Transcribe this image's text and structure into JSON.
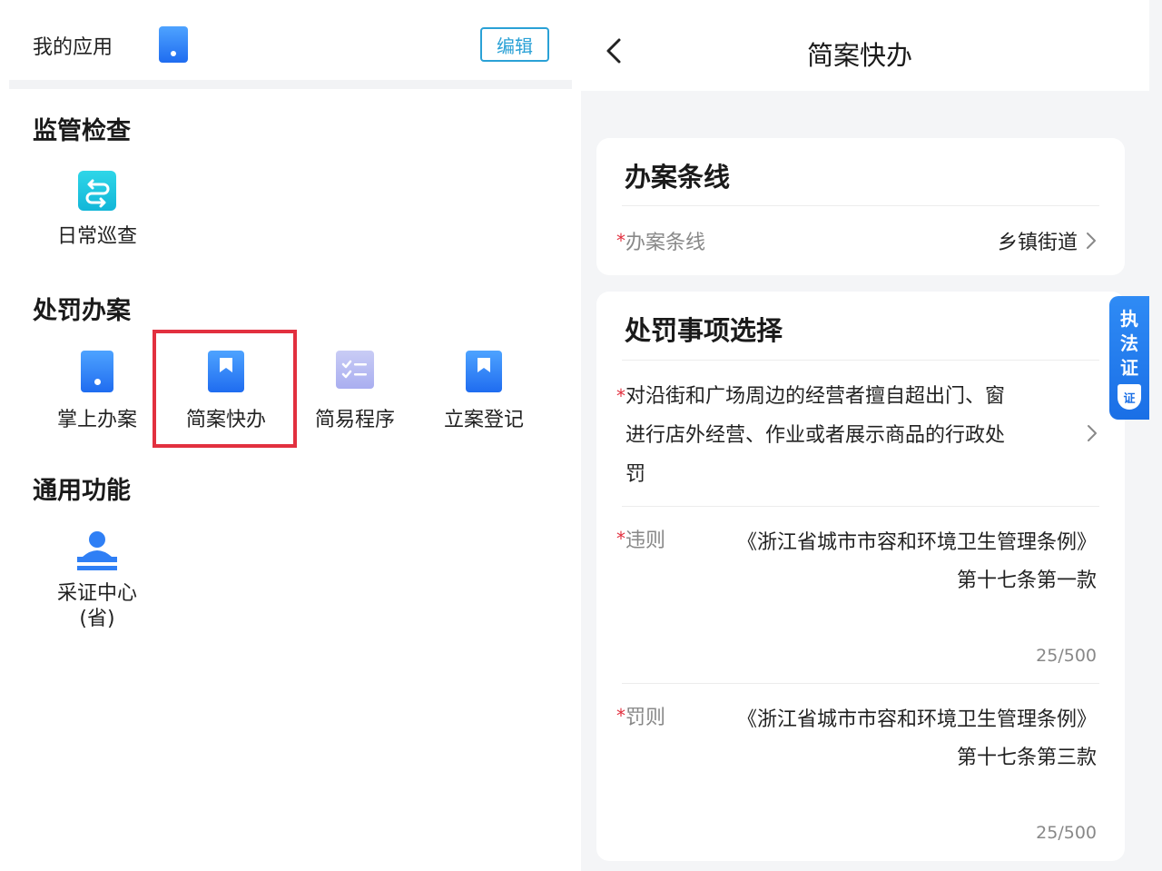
{
  "left": {
    "my_apps": {
      "title": "我的应用",
      "edit_label": "编辑"
    },
    "sections": [
      {
        "title": "监管检查",
        "items": [
          {
            "label": "日常巡查",
            "icon": "switch-arrows-icon"
          }
        ]
      },
      {
        "title": "处罚办案",
        "items": [
          {
            "label": "掌上办案",
            "icon": "phone-icon"
          },
          {
            "label": "简案快办",
            "icon": "bookmark-icon"
          },
          {
            "label": "简易程序",
            "icon": "checklist-icon"
          },
          {
            "label": "立案登记",
            "icon": "bookmark-icon"
          }
        ]
      },
      {
        "title": "通用功能",
        "items": [
          {
            "label_line1": "采证中心",
            "label_line2": "(省)",
            "icon": "stamp-icon"
          }
        ]
      }
    ]
  },
  "right": {
    "nav": {
      "title": "简案快办"
    },
    "card1": {
      "title": "办案条线",
      "field_label": "办案条线",
      "field_value": "乡镇街道"
    },
    "card2": {
      "title": "处罚事项选择",
      "matter_line1": "对沿街和广场周边的经营者擅自超出门、窗",
      "matter_line2": "进行店外经营、作业或者展示商品的行政处",
      "matter_line3": "罚",
      "violation_label": "违则",
      "violation_line1": "《浙江省城市市容和环境卫生管理条例》",
      "violation_line2": "第十七条第一款",
      "violation_counter": "25/500",
      "penalty_label": "罚则",
      "penalty_line1": "《浙江省城市市容和环境卫生管理条例》",
      "penalty_line2": "第十七条第三款",
      "penalty_counter": "25/500"
    },
    "badge": {
      "c1": "执",
      "c2": "法",
      "c3": "证",
      "shield": "证"
    },
    "required_mark": "*"
  },
  "colors": {
    "accent": "#1f6cf0",
    "edit": "#2aa1d6",
    "required": "#e2303f",
    "highlight": "#e2303f"
  }
}
